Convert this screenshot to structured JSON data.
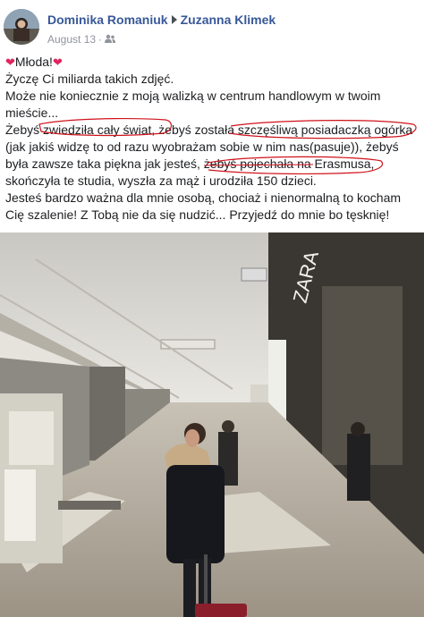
{
  "post": {
    "author": "Dominika Romaniuk",
    "recipient": "Zuzanna Klimek",
    "date": "August 13",
    "separator": "·",
    "audience_icon": "friends-icon",
    "lines": {
      "l1": "Młoda!",
      "l2": "Życzę Ci miliarda takich zdjęć.",
      "l3": "Może nie koniecznie z moją walizką w centrum handlowym w twoim mieście...",
      "l4": "Żebyś zwiedziła cały świat, żebyś została szczęśliwą posiadaczką ogórka (jak jakiś widzę to od razu wyobrażam sobie w nim nas(pasuje)), żebyś była zawsze taka piękna jak jesteś, żebyś pojechała na Erasmusa, skończyła te studia, wyszła za mąż i urodziła 150 dzieci.",
      "l5": "Jesteś bardzo ważna dla mnie osobą, chociaż i nienormalną to kocham Cię szalenie! Z Tobą nie da się nudzić... Przyjedź do mnie bo tęsknię!"
    },
    "heart_icon": "heart-icon",
    "annotation_color": "#d0121b"
  },
  "photo": {
    "description_icon": "mall-photo",
    "store_sign": "ZARA"
  }
}
